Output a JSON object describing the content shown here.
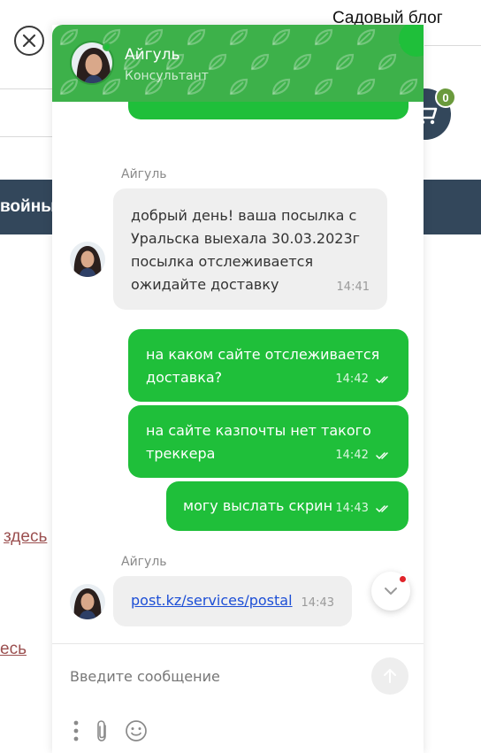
{
  "page": {
    "site_title": "Садовый блог",
    "nav_text": "войны",
    "link_1": "здесь",
    "link_2": "есь",
    "cart_count": "0"
  },
  "chat": {
    "agent_name": "Айгуль",
    "agent_role": "Консультант",
    "messages": [
      {
        "dir": "in",
        "sender": "Айгуль",
        "text": "добрый день! ваша посылка с Уральска выехала 30.03.2023г посылка отслеживается ожидайте доставку",
        "time": "14:41"
      },
      {
        "dir": "out",
        "text": "на каком сайте отслеживается доставка?",
        "time": "14:42"
      },
      {
        "dir": "out",
        "text": "на сайте казпочты нет такого треккера",
        "time": "14:42"
      },
      {
        "dir": "out",
        "text": "могу выслать скрин",
        "time": "14:43"
      },
      {
        "dir": "in",
        "sender": "Айгуль",
        "text": "post.kz/services/postal",
        "time": "14:43"
      }
    ],
    "input_placeholder": "Введите сообщение",
    "colors": {
      "brand": "#1fbf3a",
      "header": "#3db14a",
      "incoming": "#efefef",
      "notify": "#e0242a"
    },
    "icons": [
      "close-icon",
      "cart-icon",
      "double-check-icon",
      "chevron-down-icon",
      "send-arrow-icon",
      "more-vertical-icon",
      "paperclip-icon",
      "smiley-icon",
      "leaf-icon"
    ]
  }
}
